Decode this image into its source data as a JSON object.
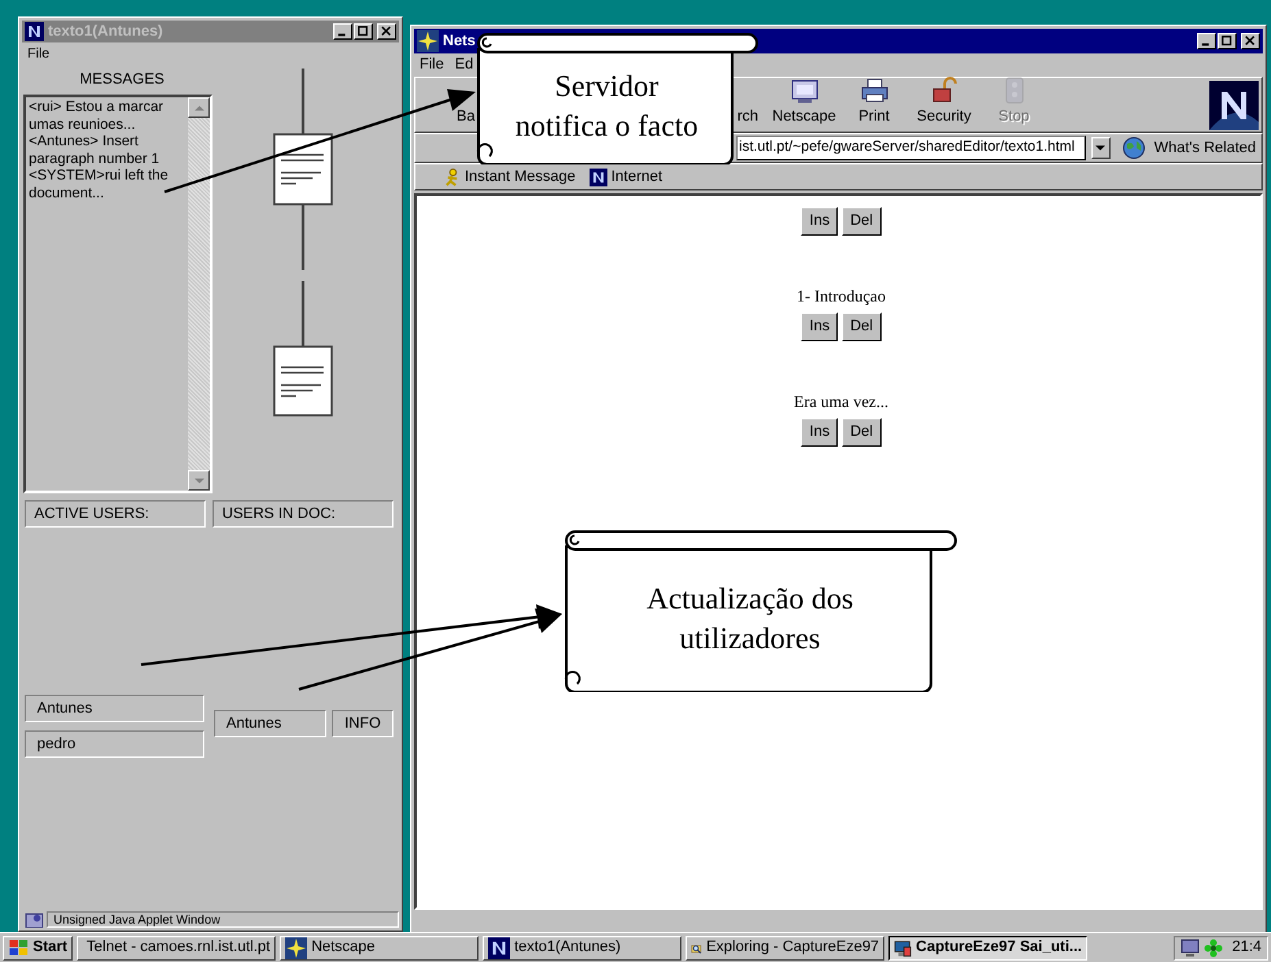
{
  "chat_window": {
    "title": "texto1(Antunes)",
    "menu": [
      "File"
    ],
    "messages_label": "MESSAGES",
    "message_lines": [
      "<rui> Estou a marcar",
      "umas reunioes...",
      "<Antunes> Insert",
      "paragraph number 1",
      "<SYSTEM>rui left the",
      "document..."
    ],
    "active_users_label": "ACTIVE USERS:",
    "users_in_doc_label": "USERS IN DOC:",
    "active_users": [
      "Antunes",
      "pedro"
    ],
    "doc_users": [
      "Antunes"
    ],
    "info_button": "INFO",
    "status": "Unsigned Java Applet Window"
  },
  "browser": {
    "title": "Nets",
    "menu": [
      "File",
      "Ed"
    ],
    "toolbar": [
      {
        "label": "Ba",
        "kind": "cut",
        "disabled": false
      },
      {
        "label": "rch",
        "kind": "cut",
        "disabled": false
      },
      {
        "label": "Netscape",
        "kind": "mynetscape",
        "disabled": false
      },
      {
        "label": "Print",
        "kind": "print",
        "disabled": false
      },
      {
        "label": "Security",
        "kind": "security",
        "disabled": false
      },
      {
        "label": "Stop",
        "kind": "stop",
        "disabled": true
      }
    ],
    "location": "ist.utl.pt/~pefe/gwareServer/sharedEditor/texto1.html",
    "whats_related": "What's Related",
    "personal_toolbar": [
      {
        "label": "Instant Message",
        "kind": "person"
      },
      {
        "label": "Internet",
        "kind": "n"
      }
    ],
    "blocks": [
      {
        "buttons": [
          "Ins",
          "Del"
        ]
      },
      {
        "text": "1- Introduçao",
        "buttons": [
          "Ins",
          "Del"
        ]
      },
      {
        "text": "Era uma vez...",
        "buttons": [
          "Ins",
          "Del"
        ]
      }
    ]
  },
  "callouts": [
    {
      "lines": [
        "Servidor",
        "notifica o facto"
      ]
    },
    {
      "lines": [
        "Actualização dos",
        "utilizadores"
      ]
    }
  ],
  "taskbar": {
    "start": "Start",
    "tasks": [
      {
        "label": "Telnet - camoes.rnl.ist.utl.pt",
        "kind": "telnet",
        "selected": false
      },
      {
        "label": "Netscape",
        "kind": "netscape",
        "selected": false
      },
      {
        "label": "texto1(Antunes)",
        "kind": "n",
        "selected": false
      },
      {
        "label": "Exploring - CaptureEze97",
        "kind": "explore",
        "selected": false
      },
      {
        "label": "CaptureEze97 Sai_uti...",
        "kind": "capture",
        "selected": true
      }
    ],
    "clock": "21:4"
  }
}
